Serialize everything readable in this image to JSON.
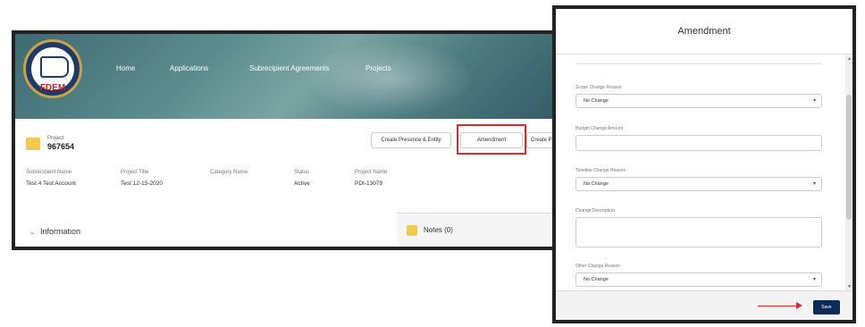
{
  "app": {
    "logo_text": "FDEM",
    "nav": [
      "Home",
      "Applications",
      "Subrecipient Agreements",
      "Projects"
    ],
    "project": {
      "label": "Project",
      "number": "967654"
    },
    "actions": {
      "create_button": "Create Presence & Entity",
      "amendment_button": "Amendment",
      "more_button": "Create P"
    },
    "fields": [
      {
        "label": "Subrecipient Name",
        "value": "Test 4 Test Account"
      },
      {
        "label": "Project Title",
        "value": "Test 12-15-2020"
      },
      {
        "label": "Category Name",
        "value": ""
      },
      {
        "label": "Status",
        "value": "Active"
      },
      {
        "label": "Project Name",
        "value": "PDI-13079"
      }
    ],
    "information_label": "Information",
    "notes_label": "Notes (0)"
  },
  "modal": {
    "title": "Amendment",
    "fields": [
      {
        "label": "Scope Change Reason",
        "type": "select",
        "value": "No Change"
      },
      {
        "label": "Budget Change Amount",
        "type": "input",
        "value": ""
      },
      {
        "label": "Timeline Change Reason",
        "type": "select",
        "value": "No Change"
      },
      {
        "label": "Change Description",
        "type": "textarea",
        "value": ""
      },
      {
        "label": "Other Change Reason",
        "type": "select",
        "value": "No Change"
      }
    ],
    "save_label": "Save"
  },
  "colors": {
    "highlight": "#d92b2b",
    "save_button": "#0b2c55",
    "icon_yellow": "#f2c94c"
  }
}
